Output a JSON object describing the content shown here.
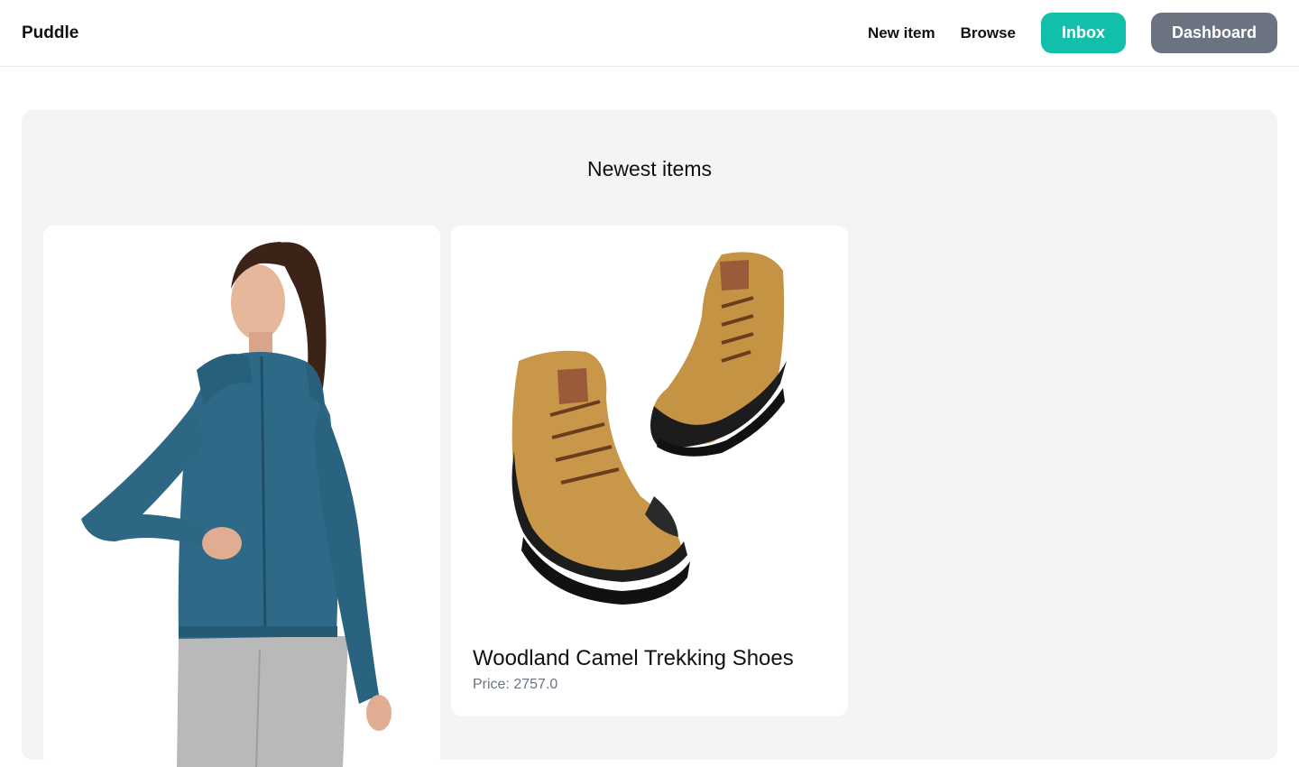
{
  "nav": {
    "brand": "Puddle",
    "links": [
      "New item",
      "Browse"
    ],
    "inbox_label": "Inbox",
    "dashboard_label": "Dashboard"
  },
  "section": {
    "title": "Newest items"
  },
  "items": [
    {
      "name": "",
      "price_text": "",
      "image": "woman-blue-zip-jacket-photo"
    },
    {
      "name": "Woodland Camel Trekking Shoes",
      "price_text": "Price: 2757.0",
      "image": "camel-trekking-boots-photo"
    }
  ],
  "colors": {
    "accent": "#11bfab",
    "secondary_button": "#6b7280",
    "panel_bg": "#f3f4f6"
  }
}
